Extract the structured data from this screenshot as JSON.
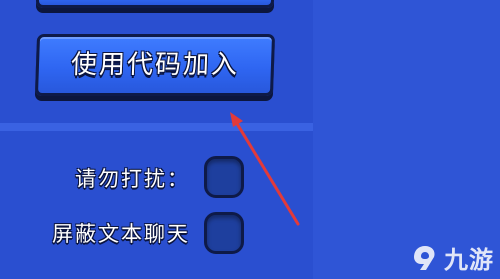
{
  "buttons": {
    "join_with_code": "使用代码加入"
  },
  "settings": {
    "do_not_disturb_label": "请勿打扰：",
    "block_text_chat_label": "屏蔽文本聊天"
  },
  "watermark": {
    "text": "九游"
  },
  "colors": {
    "background": "#2f55d6",
    "button": "#3470f5",
    "outline": "#0e1a48",
    "arrow": "#e23a3a"
  }
}
